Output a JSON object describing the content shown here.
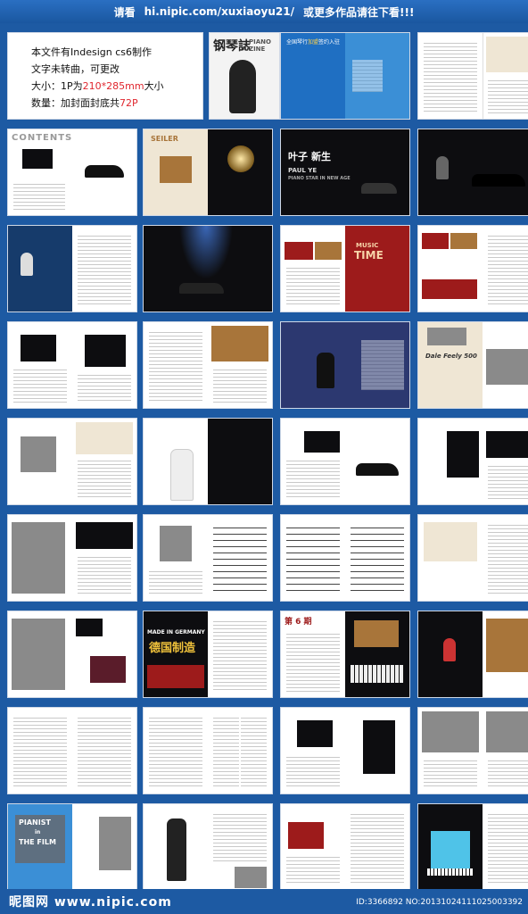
{
  "header": {
    "prefix": "请看",
    "url": "hi.nipic.com/xuxiaoyu21/",
    "suffix": "或更多作品请往下看!!!"
  },
  "info": {
    "line1": "本文件有Indesign cs6制作",
    "line2": "文字未转曲，可更改",
    "size_label": "大小：1P为",
    "size_value": "210*285mm",
    "size_suffix": "大小",
    "count_label": "数量：加封面封底共",
    "count_value": "72P"
  },
  "covers": {
    "magazine_title": "钢琴誌",
    "magazine_sub": "PIANO ZINE",
    "guide_title": "全国琴行",
    "guide_highlight": "加盟",
    "guide_rest": "签约入驻"
  },
  "spreads": {
    "contents": "CONTENTS",
    "seiler": "SEILER",
    "paul_ye_cn": "叶子",
    "paul_ye_cn2": "新生",
    "paul_ye_en": "PAUL YE",
    "paul_ye_sub": "PIANO STAR IN NEW AGE",
    "music": "MUSIC",
    "time": "TIME",
    "dale": "Dale Feely 500",
    "made_in_germany": "MADE IN GERMANY",
    "german_made": "德国制造",
    "fenglian": "第 6 期",
    "pianist": "PIANIST",
    "the_film": "THE FILM",
    "in": "in"
  },
  "footer": {
    "logo": "昵图网 www.nipic.com",
    "id_text": "ID:3366892 NO:20131024111025003392"
  }
}
